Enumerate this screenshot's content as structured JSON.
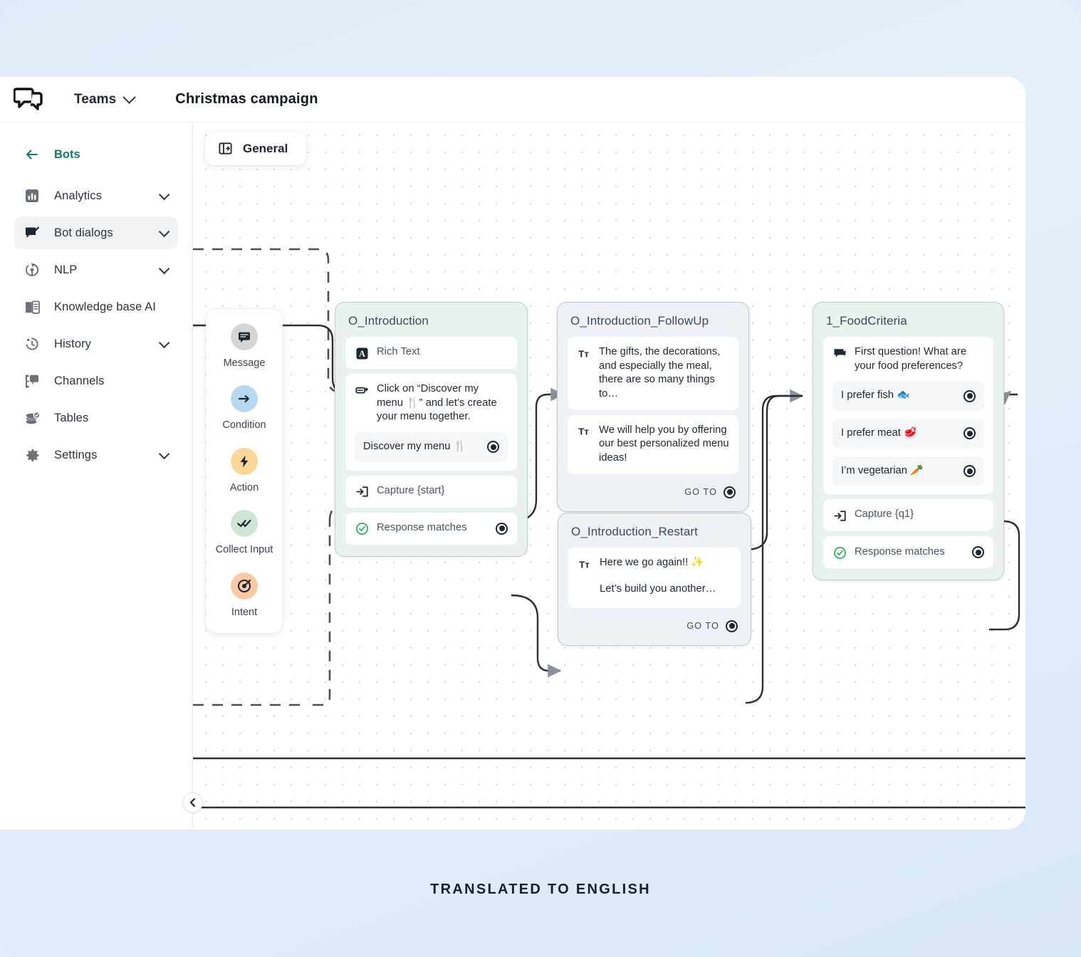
{
  "header": {
    "logo_icon": "chat-bubbles-logo",
    "teams_label": "Teams",
    "teams_chevron_icon": "chevron-down-icon",
    "doc_title": "Christmas campaign"
  },
  "sidebar": {
    "back": {
      "icon": "arrow-left-icon",
      "label": "Bots"
    },
    "items": [
      {
        "label": "Analytics",
        "icon": "analytics-icon",
        "chevron": true,
        "active": false
      },
      {
        "label": "Bot dialogs",
        "icon": "bot-dialogs-icon",
        "chevron": true,
        "active": true
      },
      {
        "label": "NLP",
        "icon": "nlp-icon",
        "chevron": true,
        "active": false
      },
      {
        "label": "Knowledge base AI",
        "icon": "knowledge-base-icon",
        "chevron": false,
        "active": false
      },
      {
        "label": "History",
        "icon": "history-icon",
        "chevron": true,
        "active": false
      },
      {
        "label": "Channels",
        "icon": "channels-icon",
        "chevron": false,
        "active": false
      },
      {
        "label": "Tables",
        "icon": "tables-icon",
        "chevron": false,
        "active": false
      },
      {
        "label": "Settings",
        "icon": "settings-gear-icon",
        "chevron": true,
        "active": false
      }
    ]
  },
  "canvas": {
    "general_tab": {
      "label": "General",
      "icon": "panel-layout-icon"
    },
    "collapse_button_icon": "chevron-left-icon",
    "palette": [
      {
        "label": "Message",
        "icon": "message-icon",
        "color": "#d3d5d7"
      },
      {
        "label": "Condition",
        "icon": "arrow-right-icon",
        "color": "#b6d8ef"
      },
      {
        "label": "Action",
        "icon": "lightning-icon",
        "color": "#fad798"
      },
      {
        "label": "Collect Input",
        "icon": "double-check-icon",
        "color": "#cfe5d4"
      },
      {
        "label": "Intent",
        "icon": "target-icon",
        "color": "#f8c9a3"
      }
    ]
  },
  "nodes": {
    "introduction": {
      "title": "O_Introduction",
      "theme": "green",
      "rich_text": {
        "icon": "rich-text-icon",
        "label": "Rich Text"
      },
      "prompt": {
        "icon": "quick-reply-icon",
        "text": "Click on “Discover my menu 🍴” and let’s create your menu together.",
        "option": {
          "label": "Discover my menu 🍴",
          "handle": "output-handle"
        }
      },
      "capture": {
        "icon": "capture-icon",
        "label": "Capture {start}"
      },
      "response": {
        "icon": "check-circle-icon",
        "label": "Response matches",
        "handle": "output-handle"
      }
    },
    "followup": {
      "title": "O_Introduction_FollowUp",
      "theme": "blue",
      "messages": [
        {
          "icon": "text-format-icon",
          "text": "The gifts, the decorations, and especially the meal, there are so many things to…"
        },
        {
          "icon": "text-format-icon",
          "text": "We will help you by offering our best personalized menu ideas!"
        }
      ],
      "goto_label": "GO TO"
    },
    "restart": {
      "title": "O_Introduction_Restart",
      "theme": "blue",
      "messages": [
        {
          "icon": "text-format-icon",
          "text": "Here we go again!! ✨",
          "text2": "Let’s build you another…"
        }
      ],
      "goto_label": "GO TO"
    },
    "foodcriteria": {
      "title": "1_FoodCriteria",
      "theme": "green",
      "question": {
        "icon": "question-bubble-icon",
        "text": "First question! What are your food preferences?"
      },
      "options": [
        {
          "label": "I prefer fish 🐟",
          "handle": "output-handle"
        },
        {
          "label": "I prefer meat 🥩",
          "handle": "output-handle"
        },
        {
          "label": "I’m vegetarian 🥕",
          "handle": "output-handle"
        }
      ],
      "capture": {
        "icon": "capture-icon",
        "label": "Capture {q1}"
      },
      "response": {
        "icon": "check-circle-icon",
        "label": "Response matches",
        "handle": "output-handle"
      }
    }
  },
  "caption": "TRANSLATED TO ENGLISH",
  "colors": {
    "accent_teal": "#0e7a6b",
    "node_green_bg": "#e9f2ec",
    "node_blue_bg": "#eef2f7",
    "page_bg": "#dfebf8"
  }
}
